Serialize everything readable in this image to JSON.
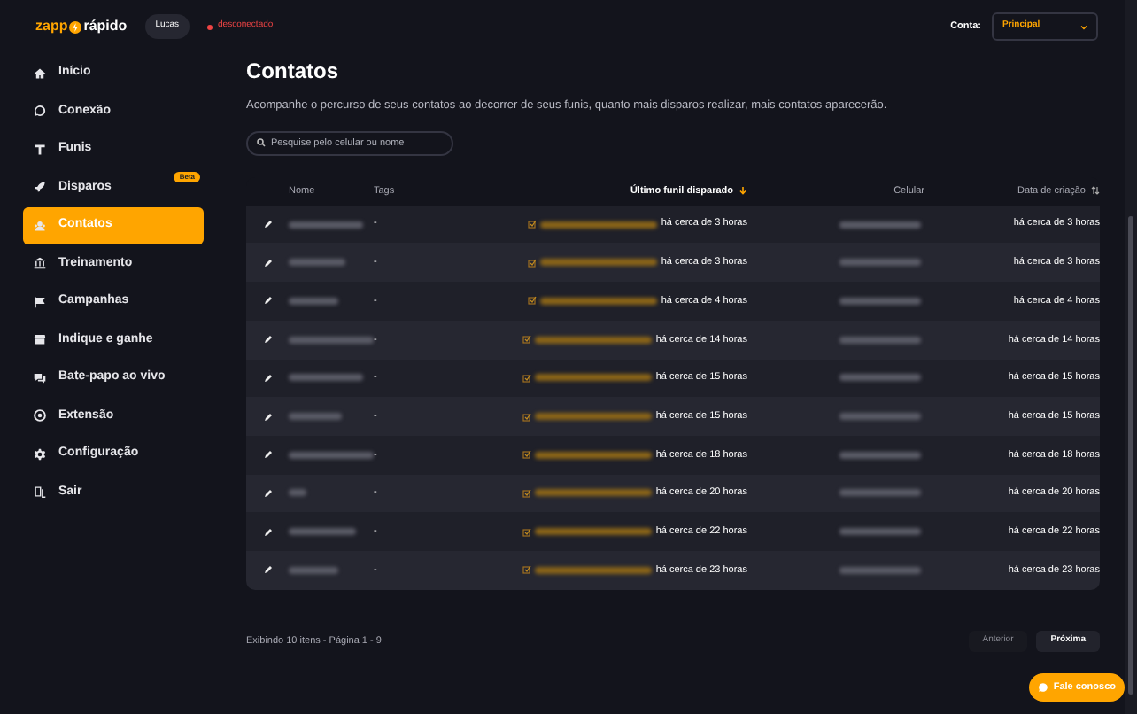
{
  "header": {
    "logo_left": "zapp",
    "logo_right": "rápido",
    "user": "Lucas",
    "connection": {
      "label": "desconectado",
      "connected": false
    },
    "account_label": "Conta:",
    "account_value": "Principal"
  },
  "sidebar": {
    "items": [
      {
        "label": "Início",
        "selected": false
      },
      {
        "label": "Conexão",
        "selected": false
      },
      {
        "label": "Funis",
        "selected": false
      },
      {
        "label": "Disparos",
        "selected": false,
        "badge": "Beta"
      },
      {
        "label": "Contatos",
        "selected": true
      },
      {
        "label": "Treinamento",
        "selected": false
      },
      {
        "label": "Campanhas",
        "selected": false
      },
      {
        "label": "Indique e ganhe",
        "selected": false
      },
      {
        "label": "Bate-papo ao vivo",
        "selected": false
      },
      {
        "label": "Extensão",
        "selected": false
      },
      {
        "label": "Configuração",
        "selected": false
      },
      {
        "label": "Sair",
        "selected": false
      }
    ]
  },
  "page": {
    "title": "Contatos",
    "description": "Acompanhe o percurso de seus contatos ao decorrer de seus funis, quanto mais disparos realizar, mais contatos aparecerão.",
    "search": {
      "placeholder": "Pesquise pelo celular ou nome"
    }
  },
  "table": {
    "columns": [
      {
        "label": "Nome",
        "kind": "plain"
      },
      {
        "label": "Tags",
        "kind": "plain"
      },
      {
        "label": "Último funil disparado",
        "kind": "sorted"
      },
      {
        "label": "Celular",
        "kind": "plain"
      },
      {
        "label": "Data de criação",
        "kind": "sortable"
      }
    ],
    "rows": [
      {
        "tags": "-",
        "last_funnel": "há cerca de 3 horas",
        "created": "há cerca de 3 horas"
      },
      {
        "tags": "-",
        "last_funnel": "há cerca de 3 horas",
        "created": "há cerca de 3 horas"
      },
      {
        "tags": "-",
        "last_funnel": "há cerca de 4 horas",
        "created": "há cerca de 4 horas"
      },
      {
        "tags": "-",
        "last_funnel": "há cerca de 14 horas",
        "created": "há cerca de 14 horas"
      },
      {
        "tags": "-",
        "last_funnel": "há cerca de 15 horas",
        "created": "há cerca de 15 horas"
      },
      {
        "tags": "-",
        "last_funnel": "há cerca de 15 horas",
        "created": "há cerca de 15 horas"
      },
      {
        "tags": "-",
        "last_funnel": "há cerca de 18 horas",
        "created": "há cerca de 18 horas"
      },
      {
        "tags": "-",
        "last_funnel": "há cerca de 20 horas",
        "created": "há cerca de 20 horas"
      },
      {
        "tags": "-",
        "last_funnel": "há cerca de 22 horas",
        "created": "há cerca de 22 horas"
      },
      {
        "tags": "-",
        "last_funnel": "há cerca de 23 horas",
        "created": "há cerca de 23 horas"
      }
    ]
  },
  "pagination": {
    "summary": "Exibindo 10 itens - Página 1 - 9",
    "buttons": [
      {
        "label": "Anterior",
        "disabled": true
      },
      {
        "label": "Próxima",
        "disabled": false
      }
    ]
  },
  "chat_button": "Fale conosco"
}
